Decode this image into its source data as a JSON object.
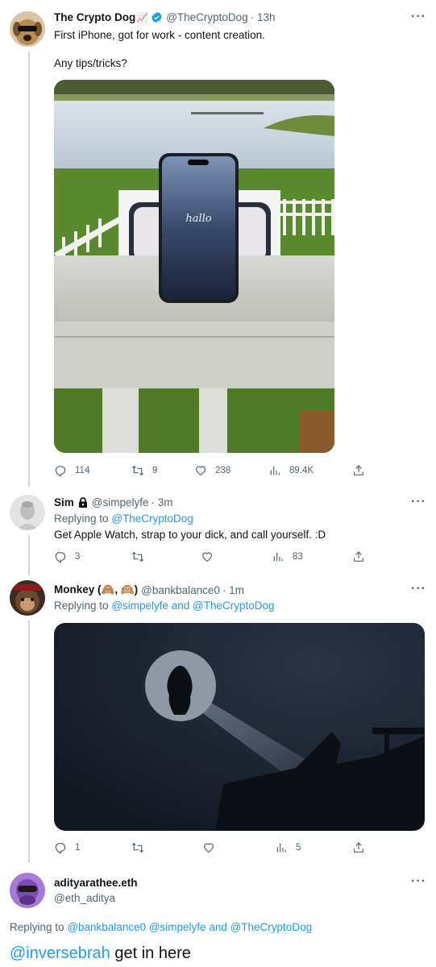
{
  "tweet1": {
    "name": "The Crypto Dog",
    "emoji": "📈",
    "handle": "@TheCryptoDog",
    "time": "· 13h",
    "line1": "First iPhone, got for work - content creation.",
    "line2": "Any tips/tricks?",
    "screen_text": "hallo",
    "stats": {
      "replies": "114",
      "retweets": "9",
      "likes": "238",
      "views": "89.4K"
    }
  },
  "tweet2": {
    "name": "Sim",
    "handle": "@simpelyfe",
    "time": "· 3m",
    "replying_prefix": "Replying to",
    "replying_to": "@TheCryptoDog",
    "text": "Get Apple Watch, strap to your dick, and call yourself. :D",
    "stats": {
      "replies": "3",
      "views": "83"
    }
  },
  "tweet3": {
    "name": "Monkey (🙈, 🙉)",
    "handle": "@bankbalance0",
    "time": "· 1m",
    "replying_prefix": "Replying to",
    "replying_to": "@simpelyfe and @TheCryptoDog",
    "stats": {
      "replies": "1",
      "views": "5"
    }
  },
  "tweet4": {
    "name": "adityarathee.eth",
    "handle": "@eth_aditya",
    "replying_prefix": "Replying to",
    "replying_to": "@bankbalance0 @simpelyfe and @TheCryptoDog",
    "mention": "@inversebrah",
    "text": " get in here"
  },
  "more_label": "···",
  "colors": {
    "link": "#1d9bf0",
    "muted": "#536471",
    "verified": "#1d9bf0"
  }
}
